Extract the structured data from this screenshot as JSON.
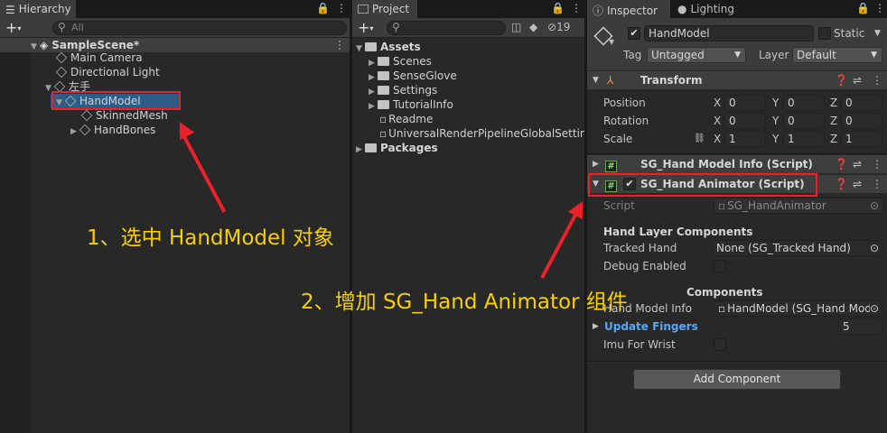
{
  "hierarchy": {
    "tab_label": "Hierarchy",
    "search_placeholder": "All",
    "scene_name": "SampleScene*",
    "items": [
      {
        "label": "Main Camera"
      },
      {
        "label": "Directional Light"
      },
      {
        "label": "左手"
      },
      {
        "label": "HandModel"
      },
      {
        "label": "SkinnedMesh"
      },
      {
        "label": "HandBones"
      }
    ]
  },
  "project": {
    "tab_label": "Project",
    "hidden_count": "19",
    "assets_label": "Assets",
    "items": [
      {
        "label": "Scenes"
      },
      {
        "label": "SenseGlove"
      },
      {
        "label": "Settings"
      },
      {
        "label": "TutorialInfo"
      },
      {
        "label": "Readme"
      },
      {
        "label": "UniversalRenderPipelineGlobalSettings"
      }
    ],
    "packages_label": "Packages"
  },
  "inspector": {
    "tab_label": "Inspector",
    "lighting_tab_label": "Lighting",
    "object_name": "HandModel",
    "static_label": "Static",
    "tag_label": "Tag",
    "tag_value": "Untagged",
    "layer_label": "Layer",
    "layer_value": "Default",
    "transform": {
      "title": "Transform",
      "position_label": "Position",
      "rotation_label": "Rotation",
      "scale_label": "Scale",
      "x": "X",
      "y": "Y",
      "z": "Z",
      "position": [
        "0",
        "0",
        "0"
      ],
      "rotation": [
        "0",
        "0",
        "0"
      ],
      "scale": [
        "1",
        "1",
        "1"
      ]
    },
    "model_info_title": "SG_Hand Model Info (Script)",
    "animator_title": "SG_Hand Animator (Script)",
    "script_label": "Script",
    "script_value": "SG_HandAnimator",
    "hand_layer_header": "Hand Layer Components",
    "tracked_hand_label": "Tracked Hand",
    "tracked_hand_value": "None (SG_Tracked Hand)",
    "debug_enabled_label": "Debug Enabled",
    "model_components_header": "Components",
    "hand_model_info_label": "Hand Model Info",
    "hand_model_info_value": "HandModel (SG_Hand Mode",
    "update_fingers_label": "Update Fingers",
    "update_fingers_value": "5",
    "imu_label": "Imu For Wrist",
    "add_component_label": "Add Component"
  },
  "annotations": {
    "step1": "1、选中 HandModel 对象",
    "step2": "2、增加 SG_Hand Animator 组件"
  },
  "colors": {
    "highlight_red": "#e8212b",
    "annotation_yellow": "#f6d000",
    "link_blue": "#5ba7f0"
  }
}
